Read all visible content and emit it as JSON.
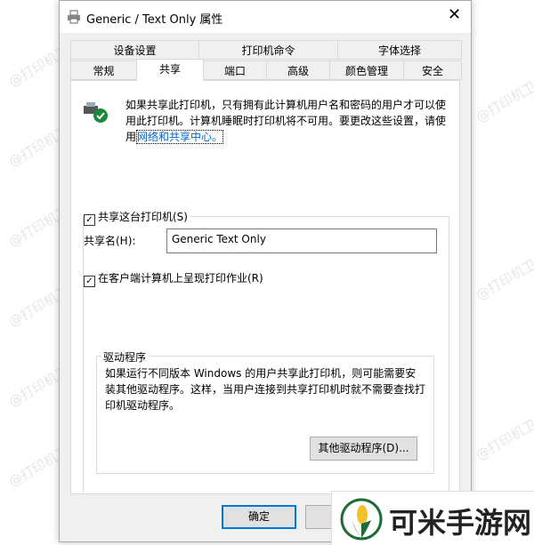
{
  "watermark": "@打印机卫士",
  "dialog": {
    "title": "Generic / Text Only 属性"
  },
  "tabs_row1": [
    "设备设置",
    "打印机命令",
    "字体选择"
  ],
  "tabs_row2": [
    "常规",
    "共享",
    "端口",
    "高级",
    "颜色管理",
    "安全"
  ],
  "selected_tab": "共享",
  "info": {
    "text": "如果共享此打印机，只有拥有此计算机用户名和密码的用户才可以使用此打印机。计算机睡眠时打印机将不可用。要更改这些设置，请使用",
    "link": "网络和共享中心。"
  },
  "share_checkbox": {
    "label": "共享这台打印机(S)",
    "checked": true
  },
  "share_name": {
    "label": "共享名(H):",
    "value": "Generic  Text Only"
  },
  "render_checkbox": {
    "label": "在客户端计算机上呈现打印作业(R)",
    "checked": true
  },
  "driver": {
    "title": "驱动程序",
    "text": "如果运行不同版本 Windows 的用户共享此打印机，则可能需要安装其他驱动程序。这样，当用户连接到共享打印机时就不需要查找打印机驱动程序。",
    "button": "其他驱动程序(D)..."
  },
  "buttons": {
    "ok": "确定"
  },
  "overlay_logo": {
    "text": "可米手游网",
    "colors": {
      "green": "#1e6b35",
      "yellow": "#f2c12e"
    }
  }
}
